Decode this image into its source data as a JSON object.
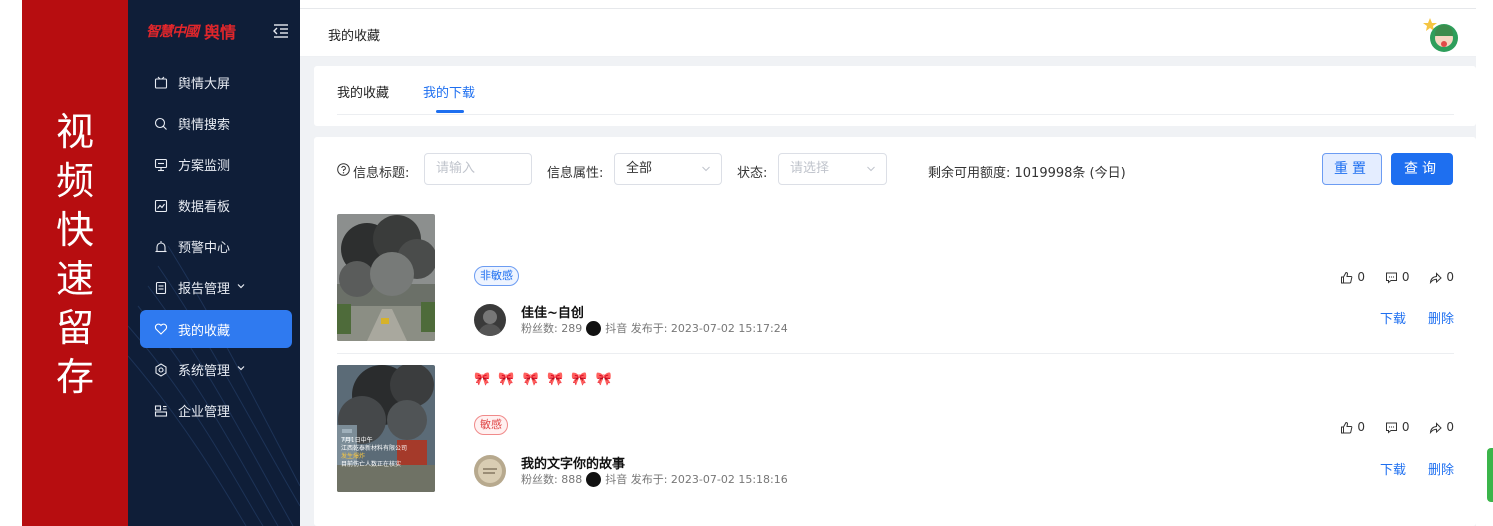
{
  "banner": {
    "chars": [
      "视",
      "频",
      "快",
      "速",
      "留",
      "存"
    ]
  },
  "sidebar": {
    "logo_script": "智慧中國",
    "logo_main": "舆情",
    "items": [
      {
        "label": "舆情大屏",
        "icon": "screen-icon"
      },
      {
        "label": "舆情搜索",
        "icon": "search-icon"
      },
      {
        "label": "方案监测",
        "icon": "monitor-icon"
      },
      {
        "label": "数据看板",
        "icon": "dashboard-icon"
      },
      {
        "label": "预警中心",
        "icon": "alert-icon"
      },
      {
        "label": "报告管理",
        "icon": "report-icon",
        "expandable": true
      },
      {
        "label": "我的收藏",
        "icon": "heart-icon",
        "active": true
      },
      {
        "label": "系统管理",
        "icon": "settings-icon",
        "expandable": true
      },
      {
        "label": "企业管理",
        "icon": "org-icon"
      }
    ]
  },
  "header": {
    "breadcrumb": "我的收藏"
  },
  "tabs": [
    {
      "label": "我的收藏",
      "active": false
    },
    {
      "label": "我的下载",
      "active": true
    }
  ],
  "filter": {
    "title_label": "信息标题:",
    "title_placeholder": "请输入",
    "attr_label": "信息属性:",
    "attr_value": "全部",
    "status_label": "状态:",
    "status_placeholder": "请选择",
    "quota": "剩余可用额度: 1019998条 (今日)",
    "reset_label": "重置",
    "search_label": "查询"
  },
  "items": [
    {
      "emoji_line": "",
      "tag": "非敏感",
      "tag_type": "non-sensitive",
      "author": "佳佳~自创",
      "fans_label": "粉丝数: 289",
      "platform_time": "抖音 发布于: 2023-07-02 15:17:24",
      "likes": "0",
      "comments": "0",
      "shares": "0",
      "download_label": "下载",
      "delete_label": "删除"
    },
    {
      "emoji_line": "🎀 🎀 🎀 🎀 🎀 🎀",
      "tag": "敏感",
      "tag_type": "sensitive",
      "author": "我的文字你的故事",
      "fans_label": "粉丝数: 888",
      "platform_time": "抖音 发布于: 2023-07-02 15:18:16",
      "likes": "0",
      "comments": "0",
      "shares": "0",
      "download_label": "下载",
      "delete_label": "删除",
      "thumb_caption": [
        "7月1日中午",
        "江西乾泰新材料有限公司",
        "发生爆炸",
        "目前伤亡人数正在核实"
      ]
    }
  ],
  "colors": {
    "brand_red": "#b70d10",
    "sidebar_bg": "#0f1e38",
    "accent": "#1e6ff0",
    "sensitive": "#e04848"
  }
}
